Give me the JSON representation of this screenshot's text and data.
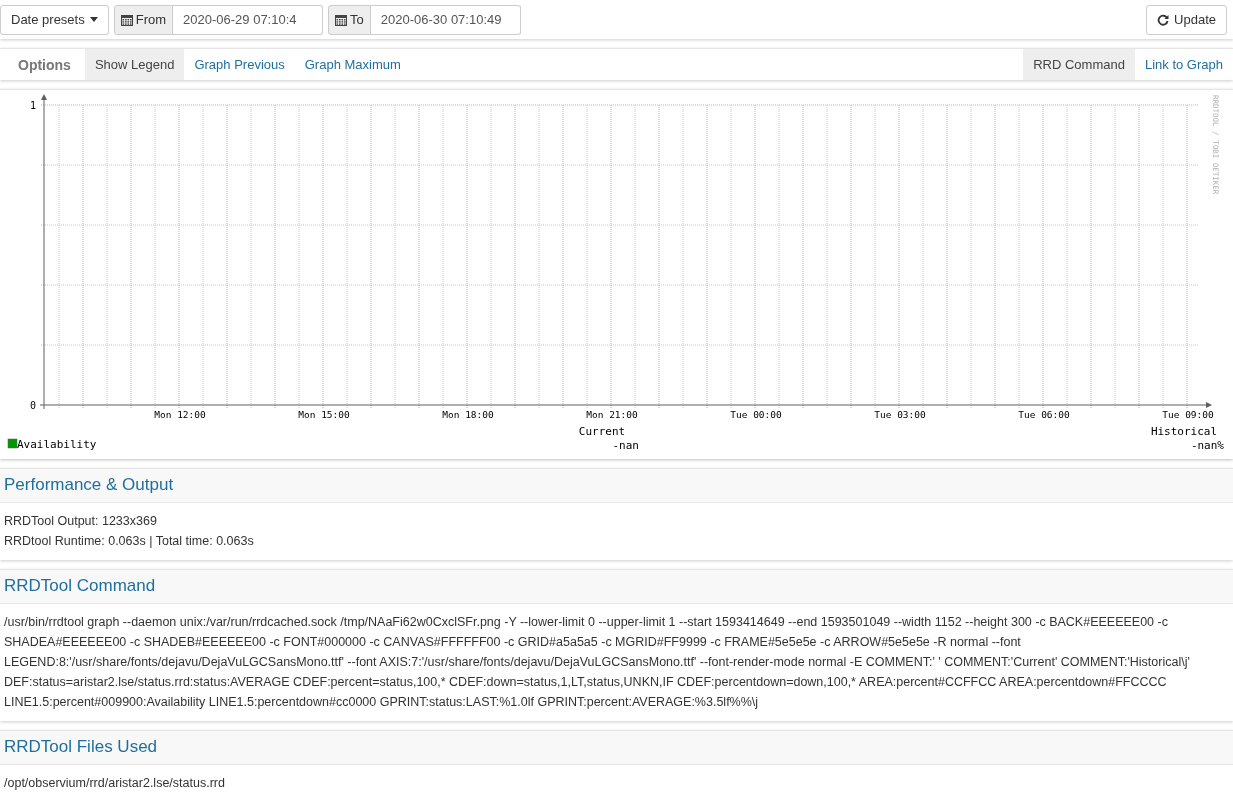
{
  "toolbar": {
    "date_presets": "Date presets",
    "from_label": "From",
    "from_value": "2020-06-29 07:10:4",
    "to_label": "To",
    "to_value": "2020-06-30 07:10:49",
    "update": "Update"
  },
  "options_bar": {
    "title": "Options",
    "left_items": [
      {
        "label": "Show Legend",
        "selected": true
      },
      {
        "label": "Graph Previous",
        "selected": false
      },
      {
        "label": "Graph Maximum",
        "selected": false
      }
    ],
    "right_items": [
      {
        "label": "RRD Command",
        "selected": true
      },
      {
        "label": "Link to Graph",
        "selected": false
      }
    ]
  },
  "graph": {
    "watermark": "RRDTOOL / TOBI OETIKER",
    "chart_data": {
      "type": "line",
      "categories": [
        "Mon 12:00",
        "Mon 15:00",
        "Mon 18:00",
        "Mon 21:00",
        "Tue 00:00",
        "Tue 03:00",
        "Tue 06:00",
        "Tue 09:00"
      ],
      "series": [
        {
          "name": "Availability",
          "color": "#009900",
          "values": [
            null,
            null,
            null,
            null,
            null,
            null,
            null,
            null
          ]
        }
      ],
      "ylim": [
        0,
        1
      ],
      "yticks": [
        0,
        1
      ],
      "grid": true
    },
    "legend": [
      {
        "heading": "Current",
        "value": "-nan"
      },
      {
        "heading": "Historical",
        "value": "-nan%"
      }
    ]
  },
  "sections": [
    {
      "title": "Performance & Output",
      "lines": [
        "RRDTool Output: 1233x369",
        "RRDtool Runtime: 0.063s | Total time: 0.063s"
      ]
    },
    {
      "title": "RRDTool Command",
      "lines": [
        "/usr/bin/rrdtool graph --daemon unix:/var/run/rrdcached.sock /tmp/NAaFi62w0CxclSFr.png -Y --lower-limit 0 --upper-limit 1 --start 1593414649 --end 1593501049 --width 1152 --height 300 -c BACK#EEEEEE00 -c SHADEA#EEEEEE00 -c SHADEB#EEEEEE00 -c FONT#000000 -c CANVAS#FFFFFF00 -c GRID#a5a5a5 -c MGRID#FF9999 -c FRAME#5e5e5e -c ARROW#5e5e5e -R normal --font LEGEND:8:'/usr/share/fonts/dejavu/DejaVuLGCSansMono.ttf' --font AXIS:7:'/usr/share/fonts/dejavu/DejaVuLGCSansMono.ttf' --font-render-mode normal -E COMMENT:' ' COMMENT:'Current' COMMENT:'Historical\\j' DEF:status=aristar2.lse/status.rrd:status:AVERAGE CDEF:percent=status,100,* CDEF:down=status,1,LT,status,UNKN,IF CDEF:percentdown=down,100,* AREA:percent#CCFFCC AREA:percentdown#FFCCCC LINE1.5:percent#009900:Availability LINE1.5:percentdown#cc0000 GPRINT:status:LAST:%1.0lf GPRINT:percent:AVERAGE:%3.5lf%%\\j"
      ]
    },
    {
      "title": "RRDTool Files Used",
      "lines": [
        "/opt/observium/rrd/aristar2.lse/status.rrd"
      ]
    }
  ]
}
